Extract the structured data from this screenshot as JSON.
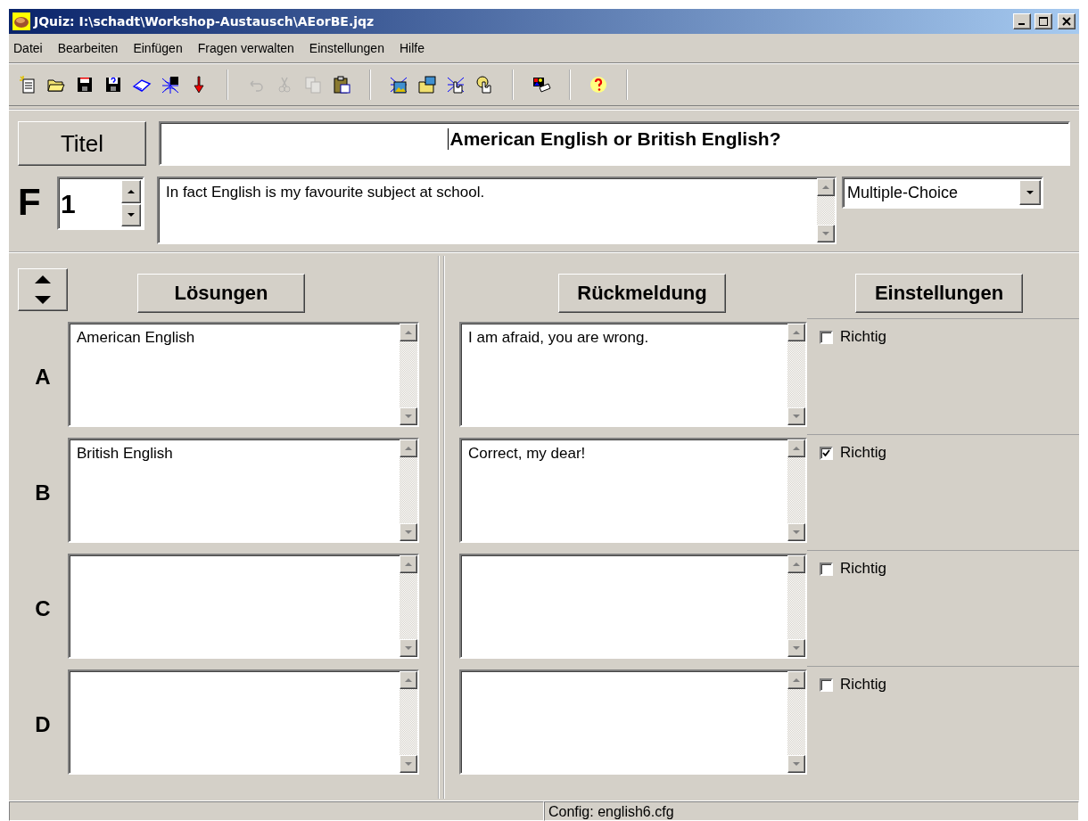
{
  "window": {
    "title": "JQuiz: I:\\schadt\\Workshop-Austausch\\AEorBE.jqz"
  },
  "menu": [
    "Datei",
    "Bearbeiten",
    "Einfügen",
    "Fragen verwalten",
    "Einstellungen",
    "Hilfe"
  ],
  "toolbar": [
    [
      {
        "disabled": false
      },
      {
        "disabled": false
      },
      {
        "disabled": false
      },
      {
        "disabled": false
      },
      {
        "disabled": false
      },
      {
        "disabled": false
      },
      {
        "disabled": false
      }
    ],
    [
      {
        "disabled": true
      },
      {
        "disabled": true
      },
      {
        "disabled": true
      },
      {
        "disabled": false
      }
    ],
    [
      {
        "disabled": false
      },
      {
        "disabled": false
      },
      {
        "disabled": false
      },
      {
        "disabled": false
      }
    ],
    [
      {
        "disabled": false
      }
    ],
    [
      {
        "disabled": false
      }
    ]
  ],
  "title_button": "Titel",
  "title_value": "American English or British English?",
  "question_label": "F",
  "question_number": "1",
  "question_text": "In fact English is my favourite subject at school.",
  "question_type": "Multiple-Choice",
  "headers": {
    "answers": "Lösungen",
    "feedback": "Rückmeldung",
    "settings": "Einstellungen"
  },
  "rows": [
    {
      "letter": "A",
      "answer": "American English",
      "feedback": "I am afraid, you are wrong.",
      "correct_label": "Richtig",
      "correct": false
    },
    {
      "letter": "B",
      "answer": "British English",
      "feedback": "Correct, my dear!",
      "correct_label": "Richtig",
      "correct": true
    },
    {
      "letter": "C",
      "correct_label": "Richtig",
      "correct": false
    },
    {
      "letter": "D",
      "correct_label": "Richtig",
      "correct": false
    }
  ],
  "status_bar": {
    "config": "Config: english6.cfg"
  }
}
